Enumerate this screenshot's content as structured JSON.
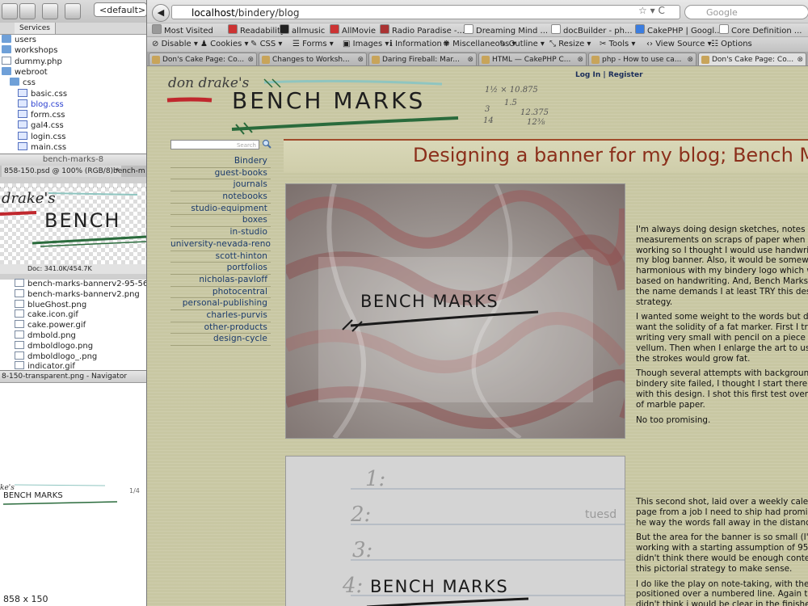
{
  "ide": {
    "default_label": "<default>",
    "tabs": [
      "Services"
    ],
    "tree_top": [
      {
        "name": "users",
        "kind": "folder"
      },
      {
        "name": "workshops",
        "kind": "folder"
      },
      {
        "name": "dummy.php",
        "kind": "file"
      },
      {
        "name": "webroot",
        "kind": "folder"
      },
      {
        "name": "css",
        "kind": "folder"
      },
      {
        "name": "basic.css",
        "kind": "css"
      },
      {
        "name": "blog.css",
        "kind": "css",
        "selected": true
      },
      {
        "name": "form.css",
        "kind": "css"
      },
      {
        "name": "gal4.css",
        "kind": "css"
      },
      {
        "name": "login.css",
        "kind": "css"
      },
      {
        "name": "main.css",
        "kind": "css"
      }
    ],
    "ps_window_title": "bench-marks-8",
    "ps_tab_1": "858-150.psd @ 100% (RGB/8) *",
    "ps_tab_2": "bench-m",
    "ps_status": "Doc: 341.0K/454.7K",
    "tree_bottom": [
      {
        "name": "bench-marks-bannerv2-95-566.p",
        "kind": "file"
      },
      {
        "name": "bench-marks-bannerv2.png",
        "kind": "file"
      },
      {
        "name": "blueGhost.png",
        "kind": "file"
      },
      {
        "name": "cake.icon.gif",
        "kind": "file"
      },
      {
        "name": "cake.power.gif",
        "kind": "file"
      },
      {
        "name": "dmbold.png",
        "kind": "file"
      },
      {
        "name": "dmboldlogo.png",
        "kind": "file"
      },
      {
        "name": "dmboldlogo_.png",
        "kind": "file"
      },
      {
        "name": "indicator.gif",
        "kind": "file"
      }
    ],
    "navigator_title": "8-150-transparent.png - Navigator",
    "navigator_size": "858 x 150"
  },
  "browser": {
    "url_host": "localhost",
    "url_path": "/bindery/blog",
    "search_placeholder": "Google",
    "bookmarks": [
      "Most Visited",
      "Readability",
      "allmusic",
      "AllMovie",
      "Radio Paradise -...",
      "Dreaming Mind ...",
      "docBuilder - ph...",
      "CakePHP | Googl...",
      "Core Definition ..."
    ],
    "webdev": [
      "Disable",
      "Cookies",
      "CSS",
      "Forms",
      "Images",
      "Information",
      "Miscellaneous",
      "Outline",
      "Resize",
      "Tools",
      "View Source",
      "Options"
    ],
    "tabs": [
      {
        "label": "Don's Cake Page: Co...",
        "active": false
      },
      {
        "label": "Changes to Worksh...",
        "active": false
      },
      {
        "label": "Daring Fireball: Mar...",
        "active": false
      },
      {
        "label": "HTML — CakePHP C...",
        "active": false
      },
      {
        "label": "php - How to use ca...",
        "active": false
      },
      {
        "label": "Don's Cake Page: Co...",
        "active": true
      }
    ]
  },
  "site": {
    "login": "Log In",
    "register": "Register",
    "search_label": "Search",
    "banner_small": "don drake's",
    "banner_big": "BENCH MARKS",
    "banner_notes": [
      "1½ × 10.875",
      "1.5",
      "3",
      "12.375",
      "14",
      "12⅜"
    ],
    "nav": [
      "Bindery",
      "guest-books",
      "journals",
      "notebooks",
      "studio-equipment",
      "boxes",
      "in-studio",
      "university-nevada-reno",
      "scott-hinton",
      "portfolios",
      "nicholas-pavloff",
      "photocentral",
      "personal-publishing",
      "charles-purvis",
      "other-products",
      "design-cycle"
    ],
    "post_title": "Designing a banner for my blog; Bench Mar",
    "photo_caption": "BENCH MARKS",
    "photo2_numbers": [
      "1:",
      "2:",
      "3:",
      "4:"
    ],
    "photo2_word": "tuesd",
    "paragraphs_1": [
      [
        "I'm always doing design sketches, notes ar",
        "measurements on scraps of paper when I'r",
        "working so I thought I would use handwrit",
        "my blog banner. Also, it would be somewh",
        "harmonious with my bindery logo which w",
        "based on handwriting. And, Bench Marks?",
        "the name demands I at least TRY this desig",
        "strategy."
      ],
      [
        "I wanted some weight to the words but dic",
        "want the solidity of a fat marker. First I tri",
        "writing very small with pencil on a piece o",
        "vellum. Then when I enlarge the art to use",
        "the strokes would grow fat."
      ],
      [
        "Though several attempts with background",
        "bindery site failed, I thought I start there a",
        "with this design. I shot this first test over a",
        "of marble paper."
      ],
      [
        "No too promising."
      ]
    ],
    "paragraphs_2": [
      [
        "This second shot, laid over a weekly calen",
        "page from a job I need to ship had promis",
        "he way the words fall away in the distance"
      ],
      [
        "But the area for the banner is so small (I'm",
        "working with a starting assumption of 95 p",
        "didn't think there would be enough contex",
        "this pictorial strategy to make sense."
      ],
      [
        "I do like the play on note-taking, with the",
        "positioned over a numbered line. Again the",
        "didn't think i would be clear in the finishe"
      ]
    ]
  },
  "colors": {
    "page_bg": "#c8c7a3",
    "title": "#8b2f1b",
    "nav_link": "#1a3a6b",
    "banner_red": "#c0272d",
    "banner_green": "#2a6b3c"
  }
}
